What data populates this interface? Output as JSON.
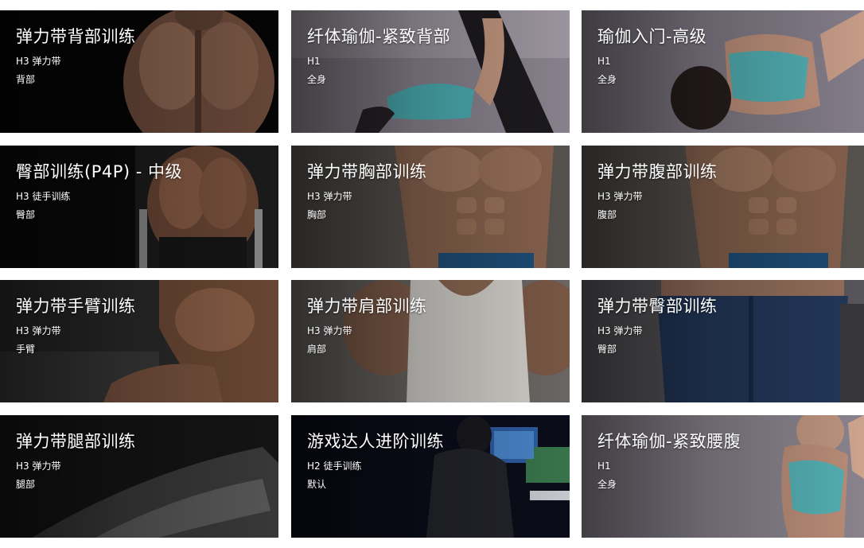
{
  "cards": [
    {
      "title": "弹力带背部训练",
      "meta": "H3 弹力带",
      "part": "背部"
    },
    {
      "title": "纤体瑜伽-紧致背部",
      "meta": "H1",
      "part": "全身"
    },
    {
      "title": "瑜伽入门-高级",
      "meta": "H1",
      "part": "全身"
    },
    {
      "title": "臀部训练(P4P) - 中级",
      "meta": "H3 徒手训练",
      "part": "臀部"
    },
    {
      "title": "弹力带胸部训练",
      "meta": "H3 弹力带",
      "part": "胸部"
    },
    {
      "title": "弹力带腹部训练",
      "meta": "H3 弹力带",
      "part": "腹部"
    },
    {
      "title": "弹力带手臂训练",
      "meta": "H3 弹力带",
      "part": "手臂"
    },
    {
      "title": "弹力带肩部训练",
      "meta": "H3 弹力带",
      "part": "肩部"
    },
    {
      "title": "弹力带臀部训练",
      "meta": "H3 弹力带",
      "part": "臀部"
    },
    {
      "title": "弹力带腿部训练",
      "meta": "H3 弹力带",
      "part": "腿部"
    },
    {
      "title": "游戏达人进阶训练",
      "meta": "H2 徒手训练",
      "part": "默认"
    },
    {
      "title": "纤体瑜伽-紧致腰腹",
      "meta": "H1",
      "part": "全身"
    }
  ]
}
